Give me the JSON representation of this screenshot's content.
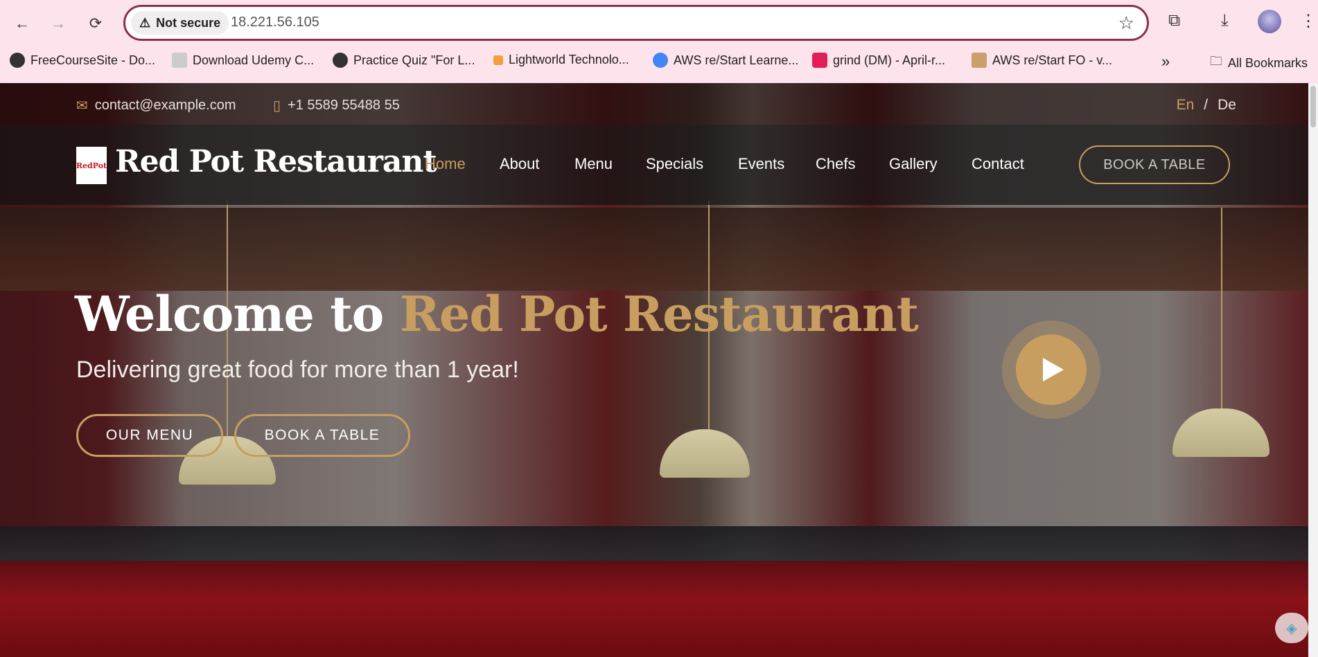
{
  "browser": {
    "security_label": "Not secure",
    "url": "18.221.56.105",
    "bookmarks": [
      {
        "label": "FreeCourseSite - Do..."
      },
      {
        "label": "Download Udemy C..."
      },
      {
        "label": "Practice Quiz \"For L..."
      },
      {
        "label": "Lightworld Technolo..."
      },
      {
        "label": "AWS re/Start Learne..."
      },
      {
        "label": "grind (DM) - April-r..."
      },
      {
        "label": "AWS re/Start FO - v..."
      }
    ],
    "more_label": "»",
    "all_bookmarks_label": "All Bookmarks"
  },
  "topbar": {
    "email": "contact@example.com",
    "phone": "+1 5589 55488 55",
    "lang_en": "En",
    "lang_sep": "/",
    "lang_de": "De"
  },
  "header": {
    "logo_text": "RedPot",
    "brand": "Red Pot Restaurant",
    "nav": [
      "Home",
      "About",
      "Menu",
      "Specials",
      "Events",
      "Chefs",
      "Gallery",
      "Contact"
    ],
    "book_label": "BOOK A TABLE"
  },
  "hero": {
    "title_white": "Welcome to",
    "title_gold": "Red Pot Restaurant",
    "subtitle": "Delivering great food for more than 1 year!",
    "menu_button": "OUR MENU",
    "book_button": "BOOK A TABLE"
  },
  "colors": {
    "accent": "#c89e60",
    "chrome": "#fde3ec",
    "address_border": "#8a2f50"
  }
}
